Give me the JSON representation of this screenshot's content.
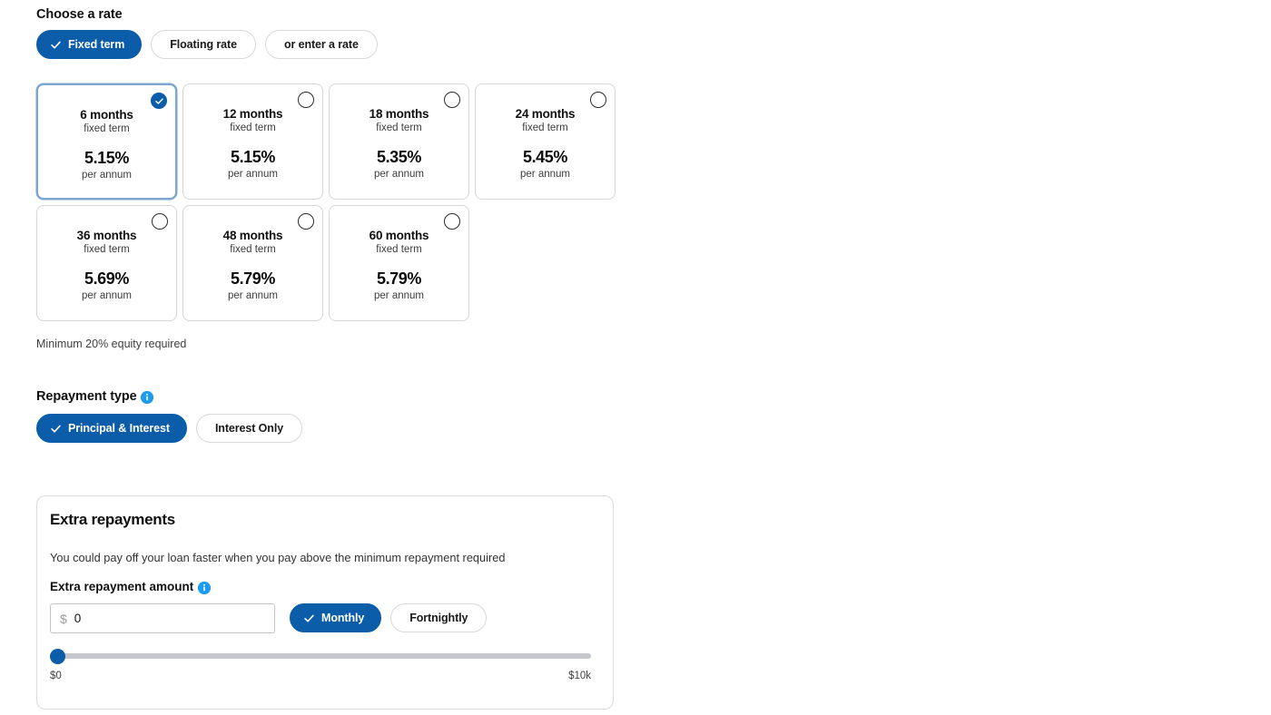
{
  "rate_section": {
    "heading": "Choose a rate",
    "tabs": [
      {
        "label": "Fixed term",
        "selected": true
      },
      {
        "label": "Floating rate",
        "selected": false
      },
      {
        "label": "or enter a rate",
        "selected": false
      }
    ],
    "cards": [
      {
        "term": "6 months",
        "term_sub": "fixed term",
        "rate": "5.15%",
        "rate_sub": "per annum",
        "selected": true
      },
      {
        "term": "12 months",
        "term_sub": "fixed term",
        "rate": "5.15%",
        "rate_sub": "per annum",
        "selected": false
      },
      {
        "term": "18 months",
        "term_sub": "fixed term",
        "rate": "5.35%",
        "rate_sub": "per annum",
        "selected": false
      },
      {
        "term": "24 months",
        "term_sub": "fixed term",
        "rate": "5.45%",
        "rate_sub": "per annum",
        "selected": false
      },
      {
        "term": "36 months",
        "term_sub": "fixed term",
        "rate": "5.69%",
        "rate_sub": "per annum",
        "selected": false
      },
      {
        "term": "48 months",
        "term_sub": "fixed term",
        "rate": "5.79%",
        "rate_sub": "per annum",
        "selected": false
      },
      {
        "term": "60 months",
        "term_sub": "fixed term",
        "rate": "5.79%",
        "rate_sub": "per annum",
        "selected": false
      }
    ],
    "note": "Minimum 20% equity required"
  },
  "repayment_type": {
    "heading": "Repayment type",
    "info_icon": "info-icon",
    "options": [
      {
        "label": "Principal & Interest",
        "selected": true
      },
      {
        "label": "Interest Only",
        "selected": false
      }
    ]
  },
  "extra_repayments": {
    "title": "Extra repayments",
    "description": "You could pay off your loan faster when you pay above the minimum repayment required",
    "amount_label": "Extra repayment amount",
    "info_icon": "info-icon",
    "currency_symbol": "$",
    "amount_value": "0",
    "amount_placeholder": "0",
    "frequency_options": [
      {
        "label": "Monthly",
        "selected": true
      },
      {
        "label": "Fortnightly",
        "selected": false
      }
    ],
    "slider": {
      "min_label": "$0",
      "max_label": "$10k",
      "value_percent": 0
    }
  },
  "colors": {
    "brand_blue": "#0b5ca9",
    "info_blue": "#1d9bf0",
    "card_border": "#d6d6d6",
    "selected_card_border": "#7ba7d0",
    "track_grey": "#c6c7cc"
  }
}
